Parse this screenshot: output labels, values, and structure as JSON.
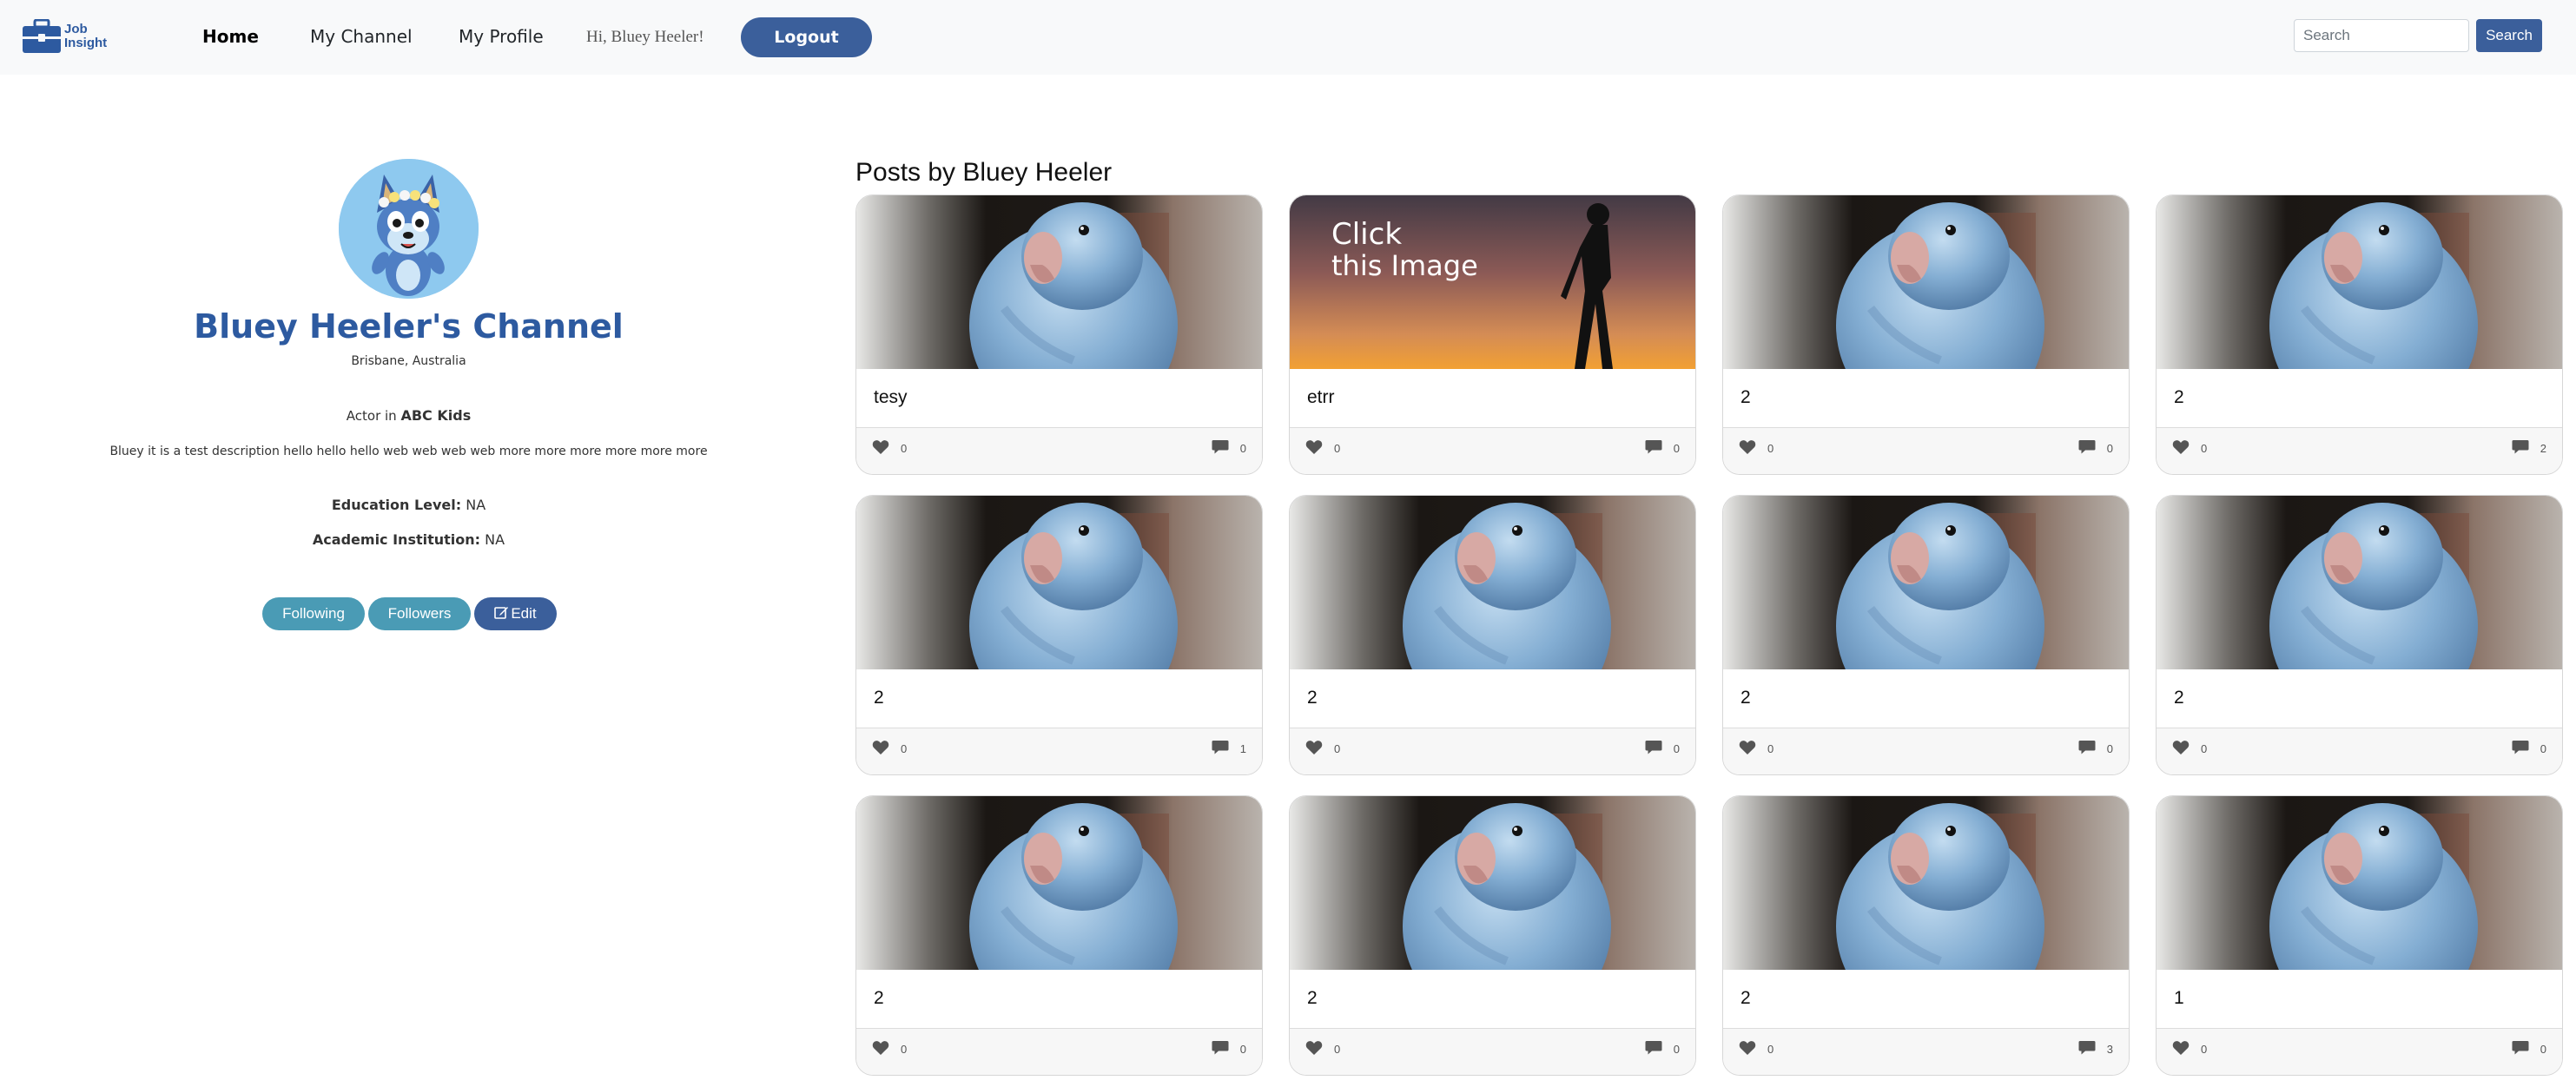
{
  "navbar": {
    "brand_line1": "Job",
    "brand_line2": "Insight",
    "links": [
      "Home",
      "My Channel",
      "My Profile"
    ],
    "greeting": "Hi, Bluey Heeler!",
    "logout_label": "Logout",
    "search_placeholder": "Search",
    "search_button": "Search"
  },
  "profile": {
    "channel_title": "Bluey Heeler's Channel",
    "location": "Brisbane,  Australia",
    "role_prefix": "Actor in",
    "role_company": "ABC Kids",
    "description": "Bluey it is a test description hello hello hello web web web web more more more more more more",
    "education_label": "Education Level:",
    "education_value": "NA",
    "institution_label": "Academic Institution:",
    "institution_value": "NA",
    "buttons": {
      "following": "Following",
      "followers": "Followers",
      "edit": "Edit"
    }
  },
  "posts": {
    "heading": "Posts by Bluey Heeler",
    "items": [
      {
        "title": "tesy",
        "likes": "0",
        "comments": "0",
        "image": "parrot"
      },
      {
        "title": "etrr",
        "likes": "0",
        "comments": "0",
        "image": "sunset",
        "overlay_line1": "Click",
        "overlay_line2": "this Image"
      },
      {
        "title": "2",
        "likes": "0",
        "comments": "0",
        "image": "parrot"
      },
      {
        "title": "2",
        "likes": "0",
        "comments": "2",
        "image": "parrot"
      },
      {
        "title": "2",
        "likes": "0",
        "comments": "1",
        "image": "parrot"
      },
      {
        "title": "2",
        "likes": "0",
        "comments": "0",
        "image": "parrot"
      },
      {
        "title": "2",
        "likes": "0",
        "comments": "0",
        "image": "parrot"
      },
      {
        "title": "2",
        "likes": "0",
        "comments": "0",
        "image": "parrot"
      },
      {
        "title": "2",
        "likes": "0",
        "comments": "0",
        "image": "parrot"
      },
      {
        "title": "2",
        "likes": "0",
        "comments": "0",
        "image": "parrot"
      },
      {
        "title": "2",
        "likes": "0",
        "comments": "3",
        "image": "parrot"
      },
      {
        "title": "1",
        "likes": "0",
        "comments": "0",
        "image": "parrot"
      }
    ]
  },
  "colors": {
    "brand_blue": "#2d5aa0",
    "button_blue": "#3b5f9b",
    "teal": "#4a9bb5",
    "navbar_bg": "#f8f9fa"
  },
  "icons": [
    "briefcase-logo-icon",
    "heart-icon",
    "comment-icon",
    "edit-icon"
  ]
}
